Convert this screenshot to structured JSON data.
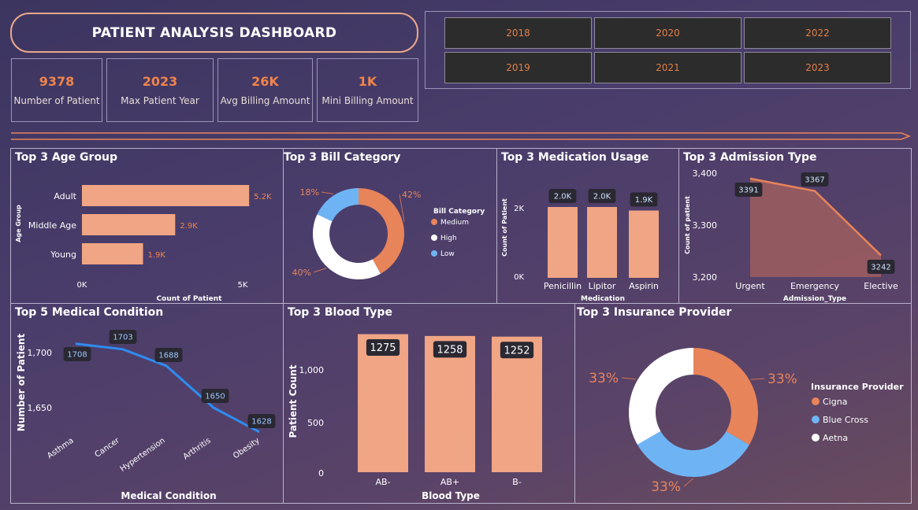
{
  "header": {
    "title": "PATIENT ANALYSIS DASHBOARD"
  },
  "kpis": [
    {
      "value": "9378",
      "label": "Number of Patient"
    },
    {
      "value": "2023",
      "label": "Max Patient Year"
    },
    {
      "value": "26K",
      "label": "Avg Billing Amount"
    },
    {
      "value": "1K",
      "label": "Mini Billing Amount"
    }
  ],
  "years": [
    "2018",
    "2020",
    "2022",
    "2019",
    "2021",
    "2023"
  ],
  "colors": {
    "accent": "#f0a585",
    "highlight": "#f0844a",
    "line": "#2e8cf0",
    "blue": "#6eb4f5",
    "white": "#ffffff"
  },
  "chart_data": [
    {
      "id": "age",
      "type": "bar",
      "title": "Top 3 Age Group",
      "orientation": "horizontal",
      "categories": [
        "Adult",
        "Middle Age",
        "Young"
      ],
      "values": [
        5200,
        2900,
        1900
      ],
      "data_labels": [
        "5.2K",
        "2.9K",
        "1.9K"
      ],
      "xlabel": "Count of Patient",
      "ylabel": "Age Group",
      "ticks": [
        "0K",
        "5K"
      ],
      "xlim": [
        0,
        5000
      ]
    },
    {
      "id": "bill",
      "type": "pie",
      "title": "Top 3 Bill Category",
      "legend_title": "Bill Category",
      "categories": [
        "Medium",
        "High",
        "Low"
      ],
      "values": [
        42,
        40,
        18
      ],
      "data_labels": [
        "42%",
        "40%",
        "18%"
      ],
      "colors": [
        "#e8845a",
        "#ffffff",
        "#6eb4f5"
      ],
      "legend_position": "right"
    },
    {
      "id": "med",
      "type": "bar",
      "title": "Top 3 Medication Usage",
      "categories": [
        "Penicillin",
        "Lipitor",
        "Aspirin"
      ],
      "values": [
        2000,
        2000,
        1900
      ],
      "data_labels": [
        "2.0K",
        "2.0K",
        "1.9K"
      ],
      "xlabel": "Medication",
      "ylabel": "Count of Patient",
      "ticks": [
        "0K",
        "2K"
      ],
      "ylim": [
        0,
        2400
      ]
    },
    {
      "id": "adm",
      "type": "area",
      "title": "Top 3 Admission Type",
      "categories": [
        "Urgent",
        "Emergency",
        "Elective"
      ],
      "values": [
        3391,
        3367,
        3242
      ],
      "data_labels": [
        "3391",
        "3367",
        "3242"
      ],
      "xlabel": "Admission_Type",
      "ylabel": "Count of patient",
      "ticks": [
        "3,400",
        "3,300",
        "3,200"
      ],
      "ylim": [
        3200,
        3400
      ]
    },
    {
      "id": "cond",
      "type": "line",
      "title": "Top 5 Medical Condition",
      "categories": [
        "Asthma",
        "Cancer",
        "Hypertension",
        "Arthritis",
        "Obesity"
      ],
      "values": [
        1708,
        1703,
        1688,
        1650,
        1628
      ],
      "data_labels": [
        "1708",
        "1703",
        "1688",
        "1650",
        "1628"
      ],
      "xlabel": "Medical Condition",
      "ylabel": "Number of Patient",
      "ticks": [
        "1,700",
        "1,650"
      ],
      "ylim": [
        1620,
        1715
      ]
    },
    {
      "id": "blood",
      "type": "bar",
      "title": "Top 3 Blood Type",
      "categories": [
        "AB-",
        "AB+",
        "B-"
      ],
      "values": [
        1275,
        1258,
        1252
      ],
      "data_labels": [
        "1275",
        "1258",
        "1252"
      ],
      "xlabel": "Blood Type",
      "ylabel": "Patient Count",
      "ticks": [
        "1,000",
        "500",
        "0"
      ],
      "ylim": [
        0,
        1300
      ]
    },
    {
      "id": "ins",
      "type": "pie",
      "title": "Top 3 Insurance Provider",
      "legend_title": "Insurance Provider",
      "categories": [
        "Cigna",
        "Blue Cross",
        "Aetna"
      ],
      "values": [
        33.4,
        33.3,
        33.3
      ],
      "data_labels": [
        "33%",
        "33%",
        "33%"
      ],
      "colors": [
        "#e8845a",
        "#6eb4f5",
        "#ffffff"
      ],
      "legend_position": "right"
    }
  ]
}
